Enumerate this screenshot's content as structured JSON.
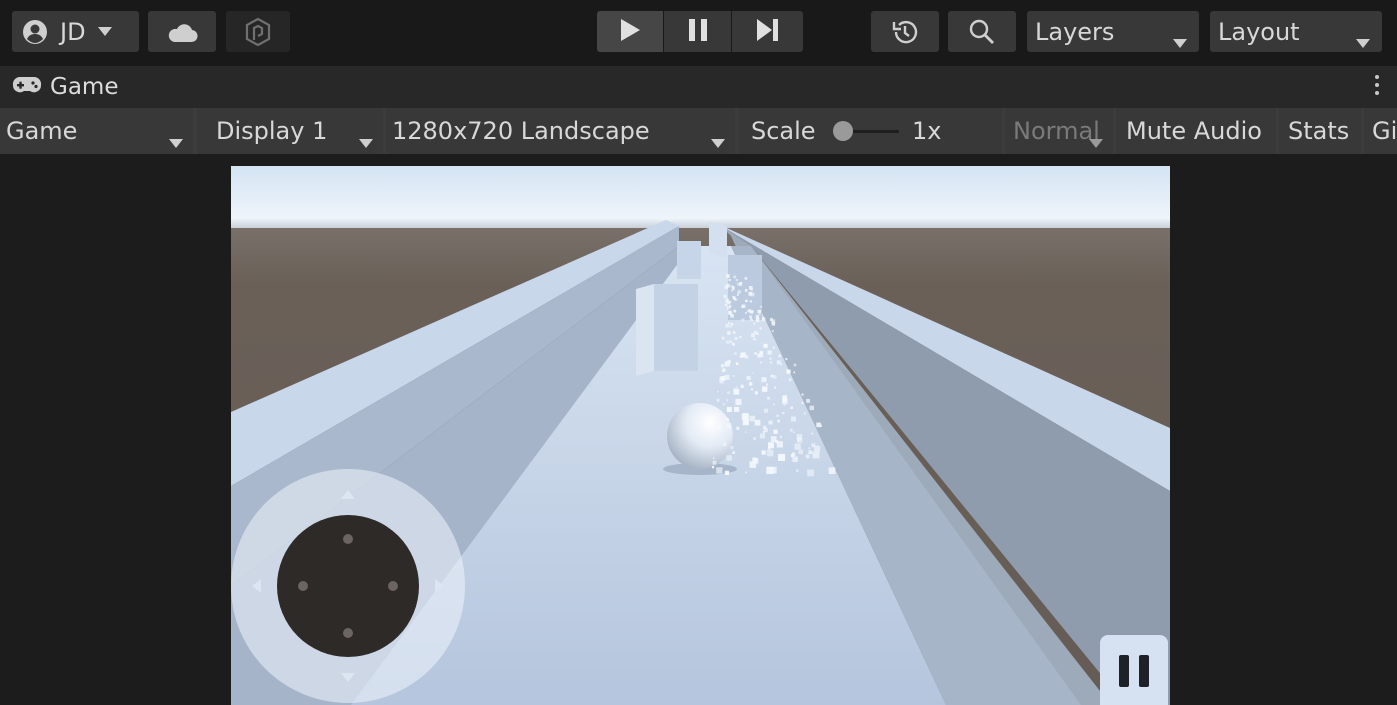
{
  "toolbar": {
    "account_label": "JD",
    "layers_label": "Layers",
    "layout_label": "Layout",
    "icons": [
      "account-icon",
      "cloud-icon",
      "collab-icon",
      "play-icon",
      "pause-icon",
      "step-icon",
      "history-icon",
      "search-icon"
    ]
  },
  "window": {
    "tab_label": "Game",
    "tab_icon": "gamepad-icon"
  },
  "gamebar": {
    "view_mode": "Game",
    "display": "Display 1",
    "resolution": "1280x720 Landscape",
    "scale_label": "Scale",
    "scale_value": "1x",
    "aspect": "Normal",
    "mute_audio": "Mute Audio",
    "stats": "Stats",
    "gizmos": "Gizmos"
  },
  "game": {
    "pause_icon": "pause-icon",
    "joystick": "virtual-joystick"
  },
  "colors": {
    "editor_bg": "#191919",
    "button_bg": "#383838",
    "sky": "#dde9f4",
    "ground_far": "#6b6058",
    "wall": "#c6d4e8",
    "floor": "#b8c8df"
  }
}
